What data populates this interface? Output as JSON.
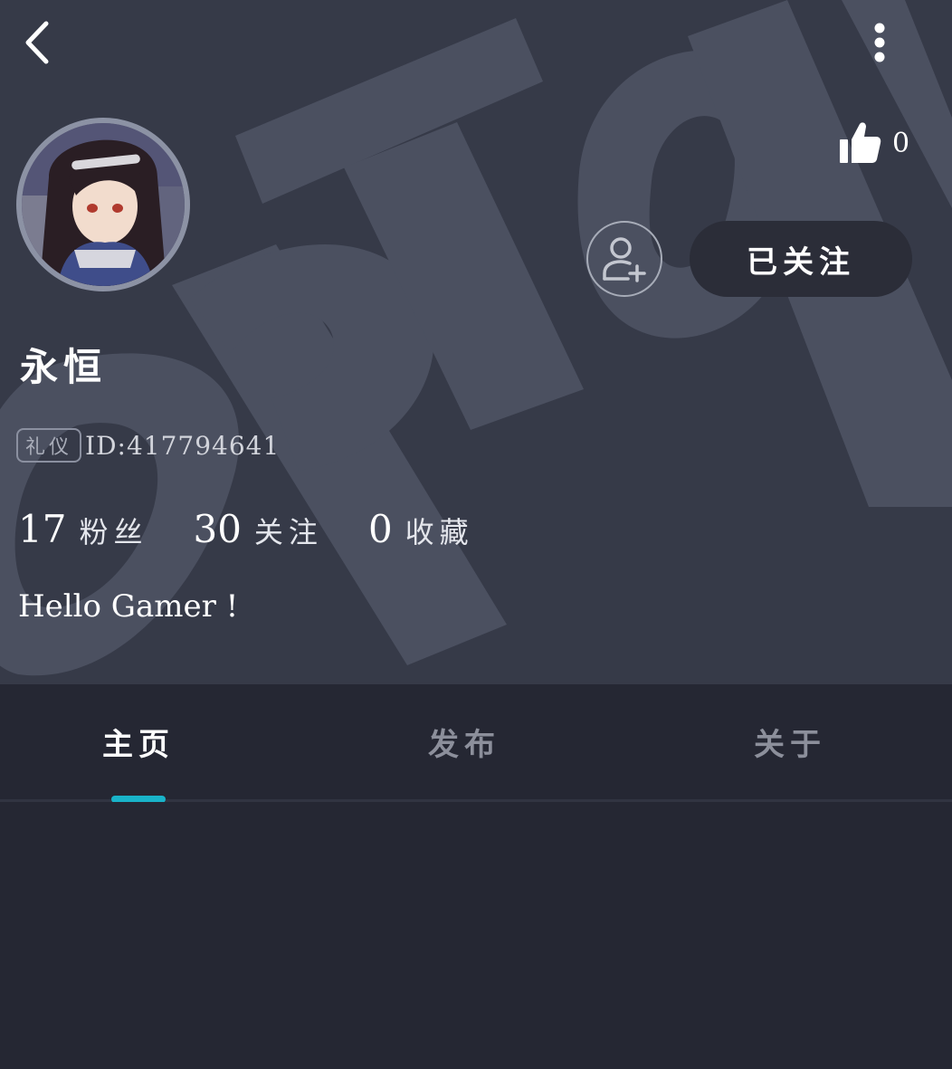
{
  "header": {
    "like_count": "0",
    "follow_label": "已关注"
  },
  "profile": {
    "username": "永恒",
    "tag": "礼仪",
    "id_text": "ID:417794641",
    "bio": "Hello Gamer !"
  },
  "stats": [
    {
      "value": "17",
      "label": "粉丝"
    },
    {
      "value": "30",
      "label": "关注"
    },
    {
      "value": "0",
      "label": "收藏"
    }
  ],
  "tabs": [
    {
      "label": "主页",
      "active": true
    },
    {
      "label": "发布",
      "active": false
    },
    {
      "label": "关于",
      "active": false
    }
  ],
  "colors": {
    "header_bg": "#363a48",
    "page_bg": "#252733",
    "accent": "#19b3c9",
    "follow_button_bg": "#2b2d38"
  }
}
